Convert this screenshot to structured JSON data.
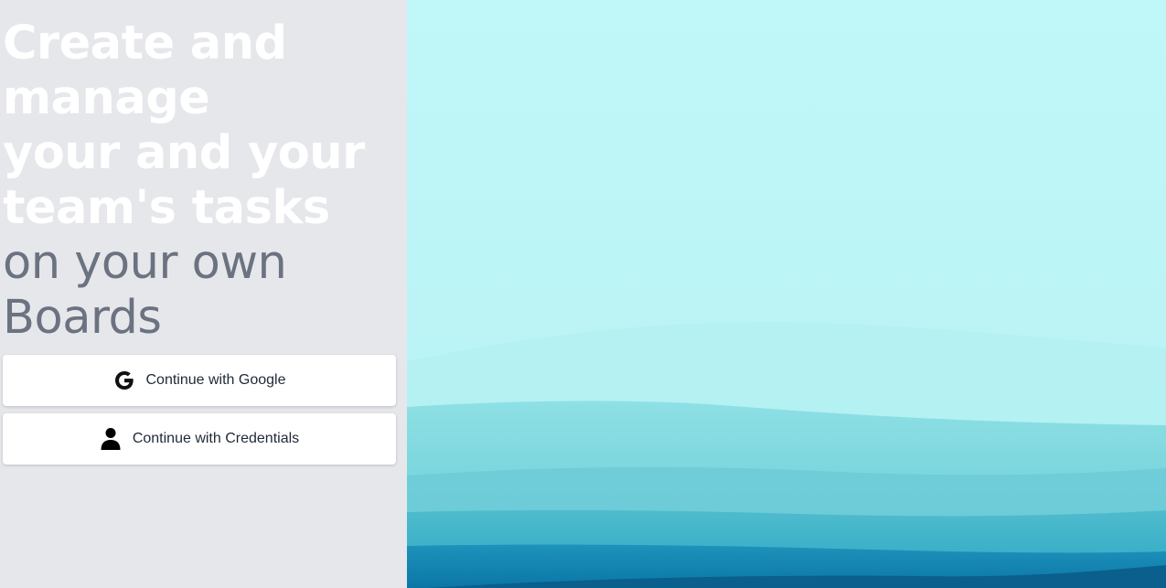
{
  "hero": {
    "headline_lines": [
      "Create and",
      "manage",
      "your and your",
      "team's tasks"
    ],
    "subline_lines": [
      "on your own",
      "Boards"
    ]
  },
  "auth": {
    "google_label": "Continue with Google",
    "credentials_label": "Continue with Credentials"
  },
  "icons": {
    "google": "google-g-icon",
    "credentials": "user-silhouette-icon"
  },
  "colors": {
    "left_background": "#e5e7eb",
    "headline": "#ffffff",
    "subline": "#6b7280",
    "sky": "#c0f6f8",
    "water_light": "#7dd8df",
    "water_mid": "#3eb3c9",
    "water_deep": "#0e7fad"
  }
}
